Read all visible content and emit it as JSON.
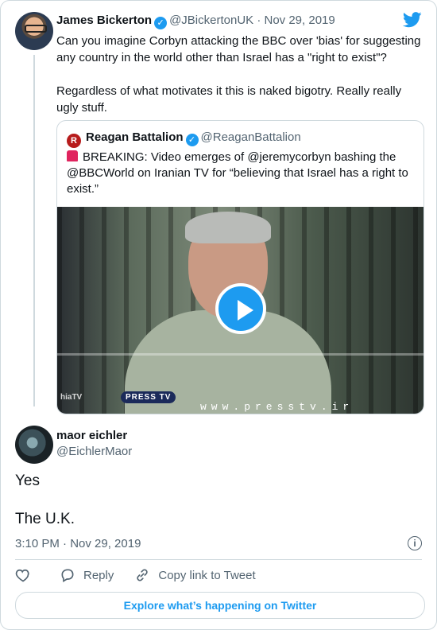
{
  "parent_tweet": {
    "author_name": "James Bickerton",
    "handle": "@JBickertonUK",
    "date": "Nov 29, 2019",
    "paragraphs": [
      "Can you imagine Corbyn attacking the BBC over 'bias' for suggesting any country in the world other than Israel has a \"right to exist\"?",
      "Regardless of what motivates it this is naked bigotry. Really really ugly stuff."
    ]
  },
  "quoted_tweet": {
    "author_name": "Reagan Battalion",
    "handle": "@ReaganBattalion",
    "logo_letter": "R",
    "text": "BREAKING: Video emerges of @jeremycorbyn bashing the @BBCWorld on Iranian TV for “believing that Israel has a right to exist.”",
    "video": {
      "watermark_left": "hiaTV",
      "badge": "PRESS TV",
      "url_text": "www.presstv.ir"
    }
  },
  "reply_tweet": {
    "author_name": "maor eichler",
    "handle": "@EichlerMaor",
    "lines": [
      "Yes",
      "The U.K."
    ],
    "timestamp": "3:10 PM · Nov 29, 2019"
  },
  "actions": {
    "reply_label": "Reply",
    "copy_label": "Copy link to Tweet"
  },
  "explore_label": "Explore what’s happening on Twitter",
  "colors": {
    "accent": "#1d9bf0",
    "text": "#0f1419",
    "muted": "#536471",
    "border": "#cfd9de"
  },
  "icons": [
    "verified-badge-icon",
    "twitter-bird-icon",
    "play-icon",
    "siren-icon",
    "heart-icon",
    "reply-icon",
    "link-icon",
    "info-icon"
  ]
}
